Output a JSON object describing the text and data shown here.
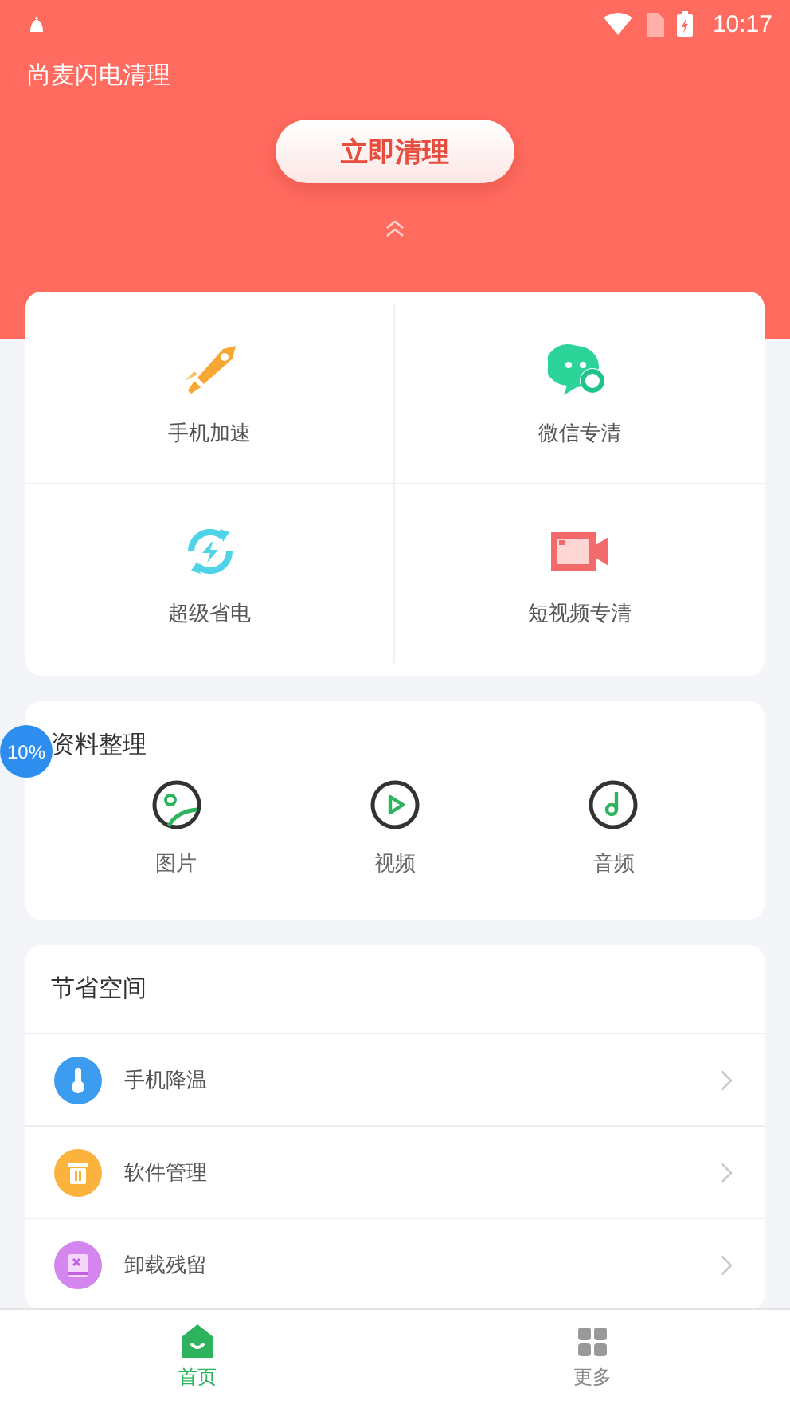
{
  "status_bar": {
    "time": "10:17"
  },
  "app_title": "尚麦闪电清理",
  "clean_button": "立即清理",
  "tools": [
    {
      "label": "手机加速",
      "kind": "rocket"
    },
    {
      "label": "微信专清",
      "kind": "chat"
    },
    {
      "label": "超级省电",
      "kind": "power"
    },
    {
      "label": "短视频专清",
      "kind": "video"
    }
  ],
  "files": {
    "title": "资料整理",
    "items": [
      {
        "label": "图片",
        "kind": "image"
      },
      {
        "label": "视频",
        "kind": "play"
      },
      {
        "label": "音频",
        "kind": "music"
      }
    ]
  },
  "float_badge": "10%",
  "space": {
    "title": "节省空间",
    "items": [
      {
        "label": "手机降温",
        "kind": "thermo"
      },
      {
        "label": "软件管理",
        "kind": "trash"
      },
      {
        "label": "卸载残留",
        "kind": "uninstall"
      }
    ]
  },
  "nav": [
    {
      "label": "首页",
      "selected": true
    },
    {
      "label": "更多",
      "selected": false
    }
  ]
}
